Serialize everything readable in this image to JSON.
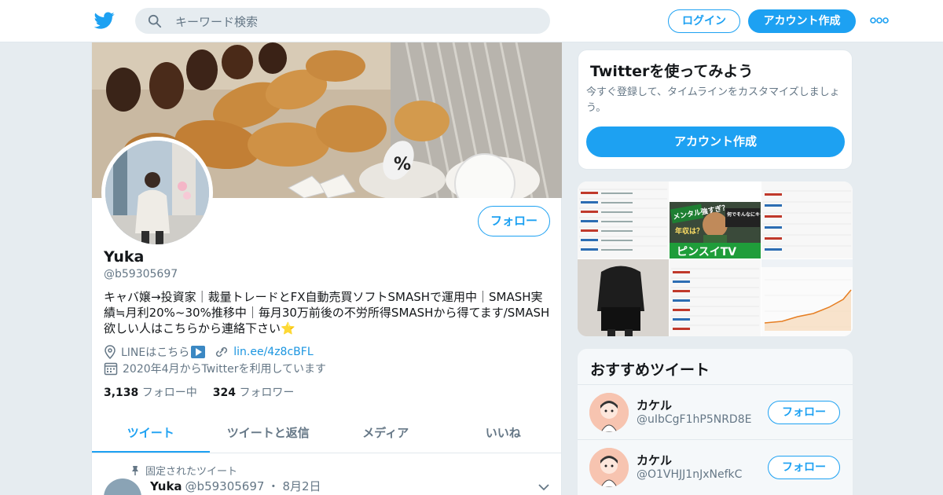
{
  "header": {
    "search_placeholder": "キーワード検索",
    "login_label": "ログイン",
    "signup_label": "アカウント作成"
  },
  "profile": {
    "name": "Yuka",
    "handle": "@b59305697",
    "follow_label": "フォロー",
    "bio": "キャバ嬢→投資家｜裁量トレードとFX自動売買ソフトSMASHで運用中｜SMASH実績≒月利20%~30%推移中｜毎月30万前後の不労所得SMASHから得てます/SMASH欲しい人はこちらから連絡下さい⭐",
    "location": "LINEはこちら",
    "url": "lin.ee/4z8cBFL",
    "joined": "2020年4月からTwitterを利用しています",
    "following_count": "3,138",
    "following_label": "フォロー中",
    "followers_count": "324",
    "followers_label": "フォロワー"
  },
  "tabs": [
    {
      "label": "ツイート",
      "active": true
    },
    {
      "label": "ツイートと返信",
      "active": false
    },
    {
      "label": "メディア",
      "active": false
    },
    {
      "label": "いいね",
      "active": false
    }
  ],
  "pinned_tweet": {
    "pin_label": "固定されたツイート",
    "author": "Yuka",
    "handle": "@b59305697",
    "separator": "・",
    "date": "8月2日"
  },
  "signup_card": {
    "title": "Twitterを使ってみよう",
    "subtitle": "今すぐ登録して、タイムラインをカスタマイズしましょう。",
    "button": "アカウント作成"
  },
  "media": {
    "overlay_1": "メンタル強すぎ？",
    "overlay_2": "年収は？",
    "overlay_3": "何でそんなにキモいの？",
    "overlay_4": "ピンスイTV"
  },
  "recommended": {
    "title": "おすすめツイート",
    "items": [
      {
        "name": "カケル",
        "handle": "@uIbCgF1hP5NRD8E",
        "button": "フォロー"
      },
      {
        "name": "カケル",
        "handle": "@O1VHJJ1nJxNefkC",
        "button": "フォロー"
      }
    ]
  },
  "colors": {
    "accent": "#1da1f2",
    "text": "#14171a",
    "muted": "#657786",
    "background": "#e6ecf0"
  }
}
